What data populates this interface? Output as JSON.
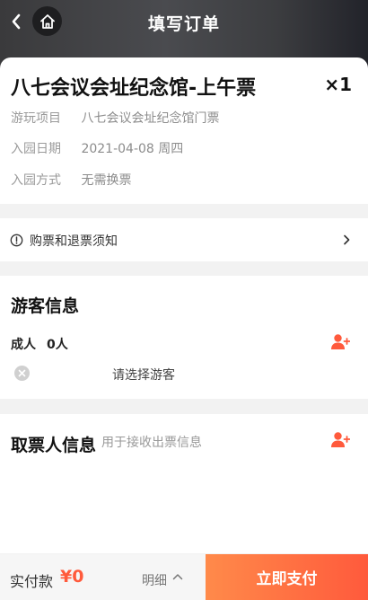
{
  "header": {
    "title": "填写订单",
    "back_icon": "chevron-left-icon",
    "home_icon": "home-icon"
  },
  "ticket": {
    "title": "八七会议会址纪念馆-上午票",
    "quantity": "×1",
    "rows": [
      {
        "label": "游玩项目",
        "value": "八七会议会址纪念馆门票"
      },
      {
        "label": "入园日期",
        "value": "2021-04-08 周四"
      },
      {
        "label": "入园方式",
        "value": "无需换票"
      }
    ]
  },
  "notice": {
    "text": "购票和退票须知",
    "icon": "info-circle-icon"
  },
  "visitor": {
    "title": "游客信息",
    "adult_label": "成人",
    "adult_count": "0人",
    "select_placeholder": "请选择游客"
  },
  "picker": {
    "title": "取票人信息",
    "subtitle": "用于接收出票信息"
  },
  "bottom": {
    "pay_label": "实付款",
    "amount": "¥0",
    "detail_label": "明细",
    "pay_button": "立即支付"
  },
  "colors": {
    "accent": "#ff5a3c",
    "accent_light": "#ff8a4a",
    "header_bg": "#3a3a3c"
  }
}
